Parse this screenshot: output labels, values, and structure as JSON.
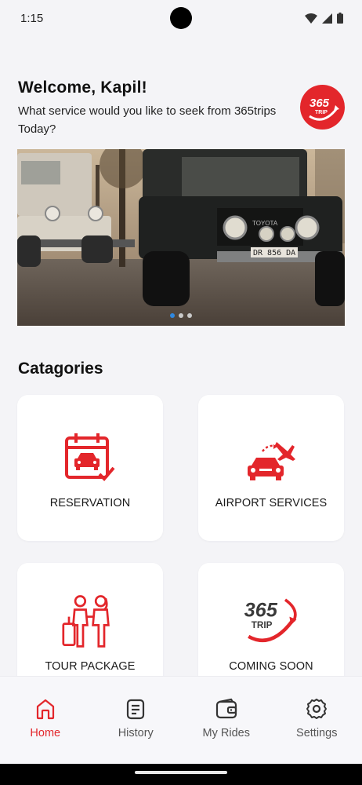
{
  "status_bar": {
    "time": "1:15"
  },
  "header": {
    "welcome": "Welcome, Kapil!",
    "subtitle": "What service would you like to seek from 365trips  Today?",
    "logo_text": "365",
    "logo_subtext": "TRIP"
  },
  "banner": {
    "slides_count": 3,
    "active_slide": 1,
    "plate_text": "DR 856 DA",
    "brand_text": "TOYOTA"
  },
  "categories": {
    "title": "Catagories",
    "items": [
      {
        "label": "RESERVATION",
        "icon": "calendar-car-icon"
      },
      {
        "label": "AIRPORT SERVICES",
        "icon": "car-airplane-icon"
      },
      {
        "label": "TOUR PACKAGE",
        "icon": "travelers-icon"
      },
      {
        "label": "COMING SOON",
        "icon": "365-trip-logo-icon"
      }
    ]
  },
  "bottom_nav": {
    "items": [
      {
        "label": "Home",
        "icon": "home-icon",
        "active": true
      },
      {
        "label": "History",
        "icon": "history-list-icon",
        "active": false
      },
      {
        "label": "My Rides",
        "icon": "wallet-icon",
        "active": false
      },
      {
        "label": "Settings",
        "icon": "gear-icon",
        "active": false
      }
    ]
  },
  "colors": {
    "accent": "#e3262b",
    "background": "#f4f4f7",
    "card": "#ffffff",
    "dot_active": "#2f88e0"
  }
}
